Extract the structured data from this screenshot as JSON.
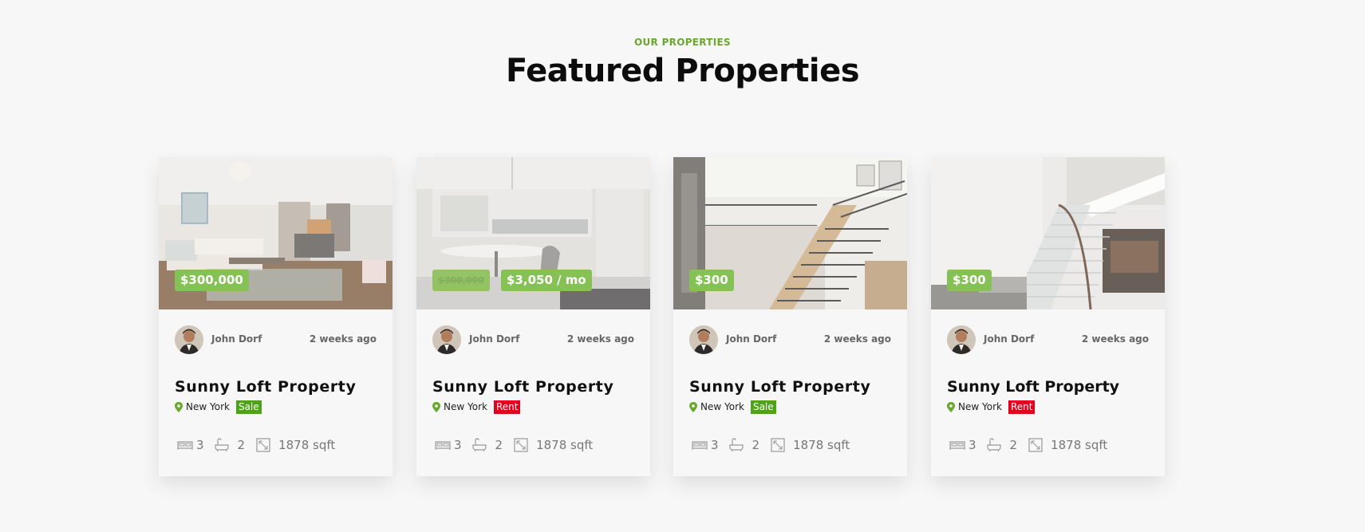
{
  "section": {
    "eyebrow": "OUR PROPERTIES",
    "title": "Featured Properties"
  },
  "colors": {
    "accent": "#6aa72f",
    "price_badge": "#86c155",
    "sale_tag": "#4ea31a",
    "rent_tag": "#e3001b"
  },
  "cards": [
    {
      "price": "$300,000",
      "old_price": "",
      "author": "John Dorf",
      "posted": "2 weeks ago",
      "title": "Sunny Loft Property",
      "city": "New York",
      "tag": "Sale",
      "beds": "3",
      "baths": "2",
      "area": "1878 sqft"
    },
    {
      "price": "$3,050 / mo",
      "old_price": "$300,000",
      "author": "John Dorf",
      "posted": "2 weeks ago",
      "title": "Sunny Loft Property",
      "city": "New York",
      "tag": "Rent",
      "beds": "3",
      "baths": "2",
      "area": "1878 sqft"
    },
    {
      "price": "$300",
      "old_price": "",
      "author": "John Dorf",
      "posted": "2 weeks ago",
      "title": "Sunny Loft Property",
      "city": "New York",
      "tag": "Sale",
      "beds": "3",
      "baths": "2",
      "area": "1878 sqft"
    },
    {
      "price": "$300",
      "old_price": "",
      "author": "John Dorf",
      "posted": "2 weeks ago",
      "title": "Sunny Loft Property",
      "city": "New York",
      "tag": "Rent",
      "beds": "3",
      "baths": "2",
      "area": "1878 sqft"
    }
  ]
}
